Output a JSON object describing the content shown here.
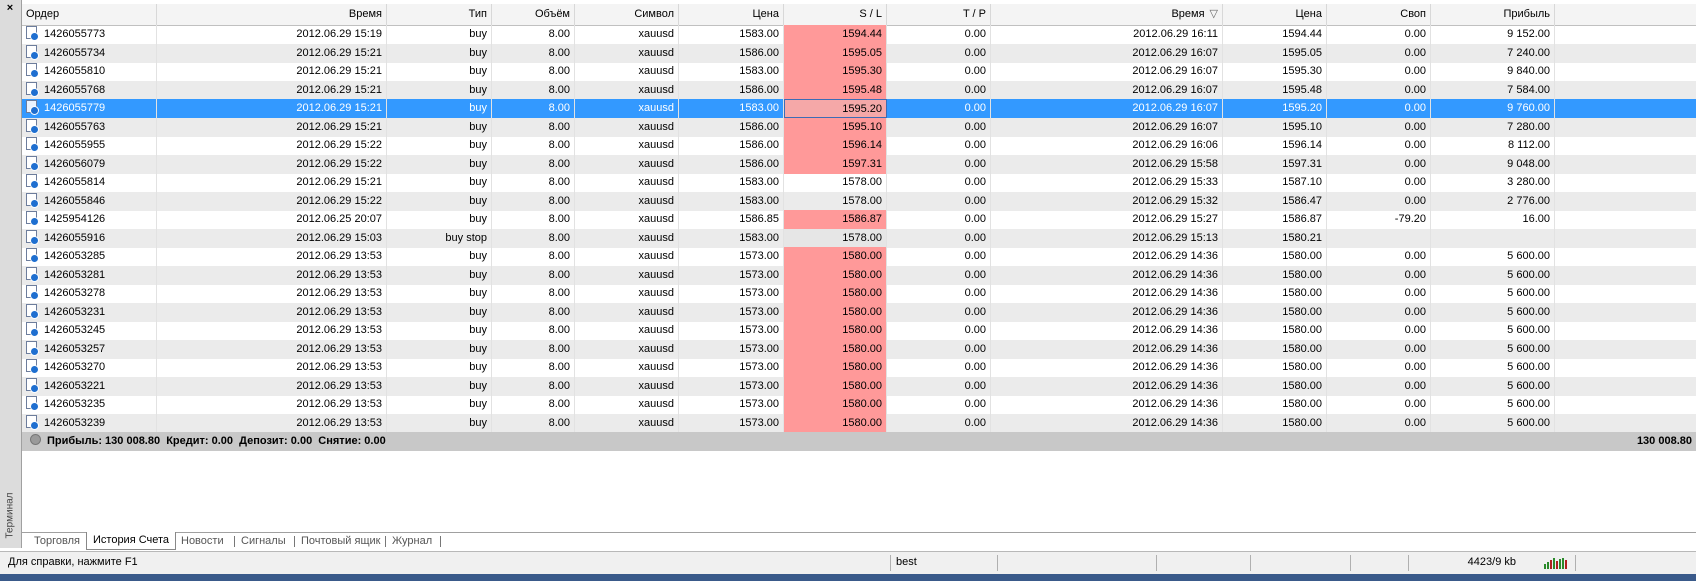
{
  "panel": {
    "close_glyph": "×",
    "side_label": "Терминал"
  },
  "columns": [
    "Ордер",
    "Время",
    "Тип",
    "Объём",
    "Символ",
    "Цена",
    "S / L",
    "T / P",
    "Время",
    "Цена",
    "Своп",
    "Прибыль"
  ],
  "sort_glyph": "▽",
  "rows": [
    {
      "order": "1426055773",
      "open_time": "2012.06.29 15:19",
      "type": "buy",
      "volume": "8.00",
      "symbol": "xauusd",
      "price": "1583.00",
      "sl": "1594.44",
      "tp": "0.00",
      "close_time": "2012.06.29 16:11",
      "close_price": "1594.44",
      "swap": "0.00",
      "profit": "9 152.00",
      "sl_hit": true
    },
    {
      "order": "1426055734",
      "open_time": "2012.06.29 15:21",
      "type": "buy",
      "volume": "8.00",
      "symbol": "xauusd",
      "price": "1586.00",
      "sl": "1595.05",
      "tp": "0.00",
      "close_time": "2012.06.29 16:07",
      "close_price": "1595.05",
      "swap": "0.00",
      "profit": "7 240.00",
      "sl_hit": true
    },
    {
      "order": "1426055810",
      "open_time": "2012.06.29 15:21",
      "type": "buy",
      "volume": "8.00",
      "symbol": "xauusd",
      "price": "1583.00",
      "sl": "1595.30",
      "tp": "0.00",
      "close_time": "2012.06.29 16:07",
      "close_price": "1595.30",
      "swap": "0.00",
      "profit": "9 840.00",
      "sl_hit": true
    },
    {
      "order": "1426055768",
      "open_time": "2012.06.29 15:21",
      "type": "buy",
      "volume": "8.00",
      "symbol": "xauusd",
      "price": "1586.00",
      "sl": "1595.48",
      "tp": "0.00",
      "close_time": "2012.06.29 16:07",
      "close_price": "1595.48",
      "swap": "0.00",
      "profit": "7 584.00",
      "sl_hit": true
    },
    {
      "order": "1426055779",
      "open_time": "2012.06.29 15:21",
      "type": "buy",
      "volume": "8.00",
      "symbol": "xauusd",
      "price": "1583.00",
      "sl": "1595.20",
      "tp": "0.00",
      "close_time": "2012.06.29 16:07",
      "close_price": "1595.20",
      "swap": "0.00",
      "profit": "9 760.00",
      "sl_hit": true,
      "selected": true
    },
    {
      "order": "1426055763",
      "open_time": "2012.06.29 15:21",
      "type": "buy",
      "volume": "8.00",
      "symbol": "xauusd",
      "price": "1586.00",
      "sl": "1595.10",
      "tp": "0.00",
      "close_time": "2012.06.29 16:07",
      "close_price": "1595.10",
      "swap": "0.00",
      "profit": "7 280.00",
      "sl_hit": true
    },
    {
      "order": "1426055955",
      "open_time": "2012.06.29 15:22",
      "type": "buy",
      "volume": "8.00",
      "symbol": "xauusd",
      "price": "1586.00",
      "sl": "1596.14",
      "tp": "0.00",
      "close_time": "2012.06.29 16:06",
      "close_price": "1596.14",
      "swap": "0.00",
      "profit": "8 112.00",
      "sl_hit": true
    },
    {
      "order": "1426056079",
      "open_time": "2012.06.29 15:22",
      "type": "buy",
      "volume": "8.00",
      "symbol": "xauusd",
      "price": "1586.00",
      "sl": "1597.31",
      "tp": "0.00",
      "close_time": "2012.06.29 15:58",
      "close_price": "1597.31",
      "swap": "0.00",
      "profit": "9 048.00",
      "sl_hit": true
    },
    {
      "order": "1426055814",
      "open_time": "2012.06.29 15:21",
      "type": "buy",
      "volume": "8.00",
      "symbol": "xauusd",
      "price": "1583.00",
      "sl": "1578.00",
      "tp": "0.00",
      "close_time": "2012.06.29 15:33",
      "close_price": "1587.10",
      "swap": "0.00",
      "profit": "3 280.00",
      "sl_hit": false
    },
    {
      "order": "1426055846",
      "open_time": "2012.06.29 15:22",
      "type": "buy",
      "volume": "8.00",
      "symbol": "xauusd",
      "price": "1583.00",
      "sl": "1578.00",
      "tp": "0.00",
      "close_time": "2012.06.29 15:32",
      "close_price": "1586.47",
      "swap": "0.00",
      "profit": "2 776.00",
      "sl_hit": false
    },
    {
      "order": "1425954126",
      "open_time": "2012.06.25 20:07",
      "type": "buy",
      "volume": "8.00",
      "symbol": "xauusd",
      "price": "1586.85",
      "sl": "1586.87",
      "tp": "0.00",
      "close_time": "2012.06.29 15:27",
      "close_price": "1586.87",
      "swap": "-79.20",
      "profit": "16.00",
      "sl_hit": true
    },
    {
      "order": "1426055916",
      "open_time": "2012.06.29 15:03",
      "type": "buy stop",
      "volume": "8.00",
      "symbol": "xauusd",
      "price": "1583.00",
      "sl": "1578.00",
      "tp": "0.00",
      "close_time": "2012.06.29 15:13",
      "close_price": "1580.21",
      "swap": "",
      "profit": "",
      "sl_hit": false,
      "pending": true
    },
    {
      "order": "1426053285",
      "open_time": "2012.06.29 13:53",
      "type": "buy",
      "volume": "8.00",
      "symbol": "xauusd",
      "price": "1573.00",
      "sl": "1580.00",
      "tp": "0.00",
      "close_time": "2012.06.29 14:36",
      "close_price": "1580.00",
      "swap": "0.00",
      "profit": "5 600.00",
      "sl_hit": true
    },
    {
      "order": "1426053281",
      "open_time": "2012.06.29 13:53",
      "type": "buy",
      "volume": "8.00",
      "symbol": "xauusd",
      "price": "1573.00",
      "sl": "1580.00",
      "tp": "0.00",
      "close_time": "2012.06.29 14:36",
      "close_price": "1580.00",
      "swap": "0.00",
      "profit": "5 600.00",
      "sl_hit": true
    },
    {
      "order": "1426053278",
      "open_time": "2012.06.29 13:53",
      "type": "buy",
      "volume": "8.00",
      "symbol": "xauusd",
      "price": "1573.00",
      "sl": "1580.00",
      "tp": "0.00",
      "close_time": "2012.06.29 14:36",
      "close_price": "1580.00",
      "swap": "0.00",
      "profit": "5 600.00",
      "sl_hit": true
    },
    {
      "order": "1426053231",
      "open_time": "2012.06.29 13:53",
      "type": "buy",
      "volume": "8.00",
      "symbol": "xauusd",
      "price": "1573.00",
      "sl": "1580.00",
      "tp": "0.00",
      "close_time": "2012.06.29 14:36",
      "close_price": "1580.00",
      "swap": "0.00",
      "profit": "5 600.00",
      "sl_hit": true
    },
    {
      "order": "1426053245",
      "open_time": "2012.06.29 13:53",
      "type": "buy",
      "volume": "8.00",
      "symbol": "xauusd",
      "price": "1573.00",
      "sl": "1580.00",
      "tp": "0.00",
      "close_time": "2012.06.29 14:36",
      "close_price": "1580.00",
      "swap": "0.00",
      "profit": "5 600.00",
      "sl_hit": true
    },
    {
      "order": "1426053257",
      "open_time": "2012.06.29 13:53",
      "type": "buy",
      "volume": "8.00",
      "symbol": "xauusd",
      "price": "1573.00",
      "sl": "1580.00",
      "tp": "0.00",
      "close_time": "2012.06.29 14:36",
      "close_price": "1580.00",
      "swap": "0.00",
      "profit": "5 600.00",
      "sl_hit": true
    },
    {
      "order": "1426053270",
      "open_time": "2012.06.29 13:53",
      "type": "buy",
      "volume": "8.00",
      "symbol": "xauusd",
      "price": "1573.00",
      "sl": "1580.00",
      "tp": "0.00",
      "close_time": "2012.06.29 14:36",
      "close_price": "1580.00",
      "swap": "0.00",
      "profit": "5 600.00",
      "sl_hit": true
    },
    {
      "order": "1426053221",
      "open_time": "2012.06.29 13:53",
      "type": "buy",
      "volume": "8.00",
      "symbol": "xauusd",
      "price": "1573.00",
      "sl": "1580.00",
      "tp": "0.00",
      "close_time": "2012.06.29 14:36",
      "close_price": "1580.00",
      "swap": "0.00",
      "profit": "5 600.00",
      "sl_hit": true
    },
    {
      "order": "1426053235",
      "open_time": "2012.06.29 13:53",
      "type": "buy",
      "volume": "8.00",
      "symbol": "xauusd",
      "price": "1573.00",
      "sl": "1580.00",
      "tp": "0.00",
      "close_time": "2012.06.29 14:36",
      "close_price": "1580.00",
      "swap": "0.00",
      "profit": "5 600.00",
      "sl_hit": true
    },
    {
      "order": "1426053239",
      "open_time": "2012.06.29 13:53",
      "type": "buy",
      "volume": "8.00",
      "symbol": "xauusd",
      "price": "1573.00",
      "sl": "1580.00",
      "tp": "0.00",
      "close_time": "2012.06.29 14:36",
      "close_price": "1580.00",
      "swap": "0.00",
      "profit": "5 600.00",
      "sl_hit": true
    }
  ],
  "summary": {
    "text": "Прибыль: 130 008.80  Кредит: 0.00  Депозит: 0.00  Снятие: 0.00",
    "total": "130 008.80"
  },
  "tabs": [
    {
      "label": "Торговля",
      "active": false
    },
    {
      "label": "История Счета",
      "active": true
    },
    {
      "label": "Новости",
      "active": false
    },
    {
      "label": "Сигналы",
      "active": false
    },
    {
      "label": "Почтовый ящик",
      "active": false
    },
    {
      "label": "Журнал",
      "active": false
    }
  ],
  "status": {
    "help": "Для справки, нажмите F1",
    "profile": "best",
    "traffic": "4423/9 kb"
  },
  "colors": {
    "selected_row": "#3399ff",
    "sl_hit": "#ff9999",
    "alt_row": "#ebebeb"
  }
}
